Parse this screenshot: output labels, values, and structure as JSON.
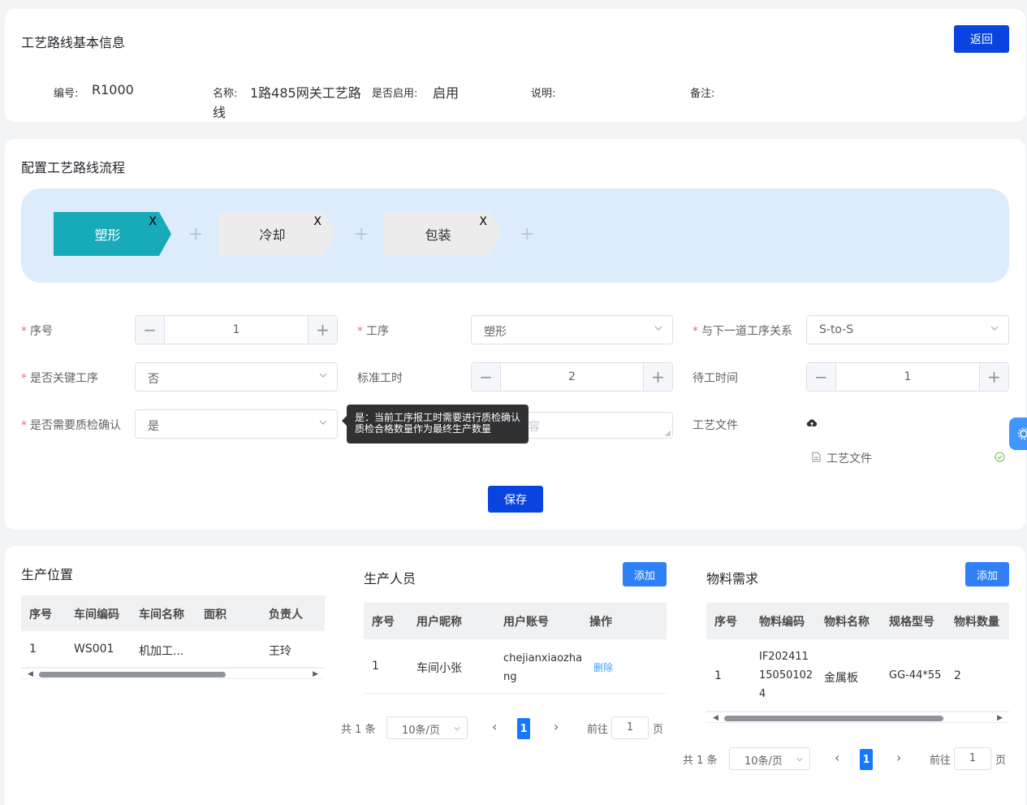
{
  "basic": {
    "title": "工艺路线基本信息",
    "back_label": "返回",
    "code_label": "编号:",
    "code_value": "R1000",
    "name_label": "名称:",
    "name_value_line1": "1路485网关工艺路",
    "name_value_line2": "线",
    "enabled_label": "是否启用:",
    "enabled_value": "启用",
    "desc_label": "说明:",
    "remark_label": "备注:"
  },
  "flow": {
    "title": "配置工艺路线流程",
    "steps": [
      {
        "label": "塑形",
        "close": "X"
      },
      {
        "label": "冷却",
        "close": "X"
      },
      {
        "label": "包装",
        "close": "X"
      }
    ],
    "plus": "+"
  },
  "form": {
    "seq_label": "序号",
    "seq_value": "1",
    "process_label": "工序",
    "process_value": "塑形",
    "relation_label": "与下一道工序关系",
    "relation_value": "S-to-S",
    "key_label": "是否关键工序",
    "key_value": "否",
    "std_label": "标准工时",
    "std_value": "2",
    "wait_label": "待工时间",
    "wait_value": "1",
    "qc_label": "是否需要质检确认",
    "qc_value": "是",
    "remark_placeholder_fragment": "容",
    "file_label": "工艺文件",
    "file_name": "工艺文件",
    "tooltip_line1": "是：当前工序报工时需要进行质检确认",
    "tooltip_line2": "质检合格数量作为最终生产数量",
    "save_label": "保存"
  },
  "location": {
    "title": "生产位置",
    "headers": [
      "序号",
      "车间编码",
      "车间名称",
      "面积",
      "负责人"
    ],
    "rows": [
      [
        "1",
        "WS001",
        "机加工...",
        "",
        "王玲"
      ]
    ]
  },
  "staff": {
    "title": "生产人员",
    "add_label": "添加",
    "headers": [
      "序号",
      "用户昵称",
      "用户账号",
      "操作"
    ],
    "rows": [
      {
        "seq": "1",
        "nick": "车间小张",
        "acct1": "chejianxiaozha",
        "acct2": "ng",
        "op": "删除"
      }
    ],
    "pager": {
      "total": "共 1 条",
      "size": "10条/页",
      "page": "1",
      "goto": "前往",
      "goto_value": "1",
      "unit": "页"
    }
  },
  "material": {
    "title": "物料需求",
    "add_label": "添加",
    "headers": [
      "序号",
      "物料编码",
      "物料名称",
      "规格型号",
      "物料数量"
    ],
    "rows": [
      {
        "seq": "1",
        "code1": "IF202411",
        "code2": "15050102",
        "code3": "4",
        "name": "金属板",
        "spec": "GG-44*55",
        "qty": "2"
      }
    ],
    "pager": {
      "total": "共 1 条",
      "size": "10条/页",
      "page": "1",
      "goto": "前往",
      "goto_value": "1",
      "unit": "页"
    }
  },
  "colors": {
    "primary": "#0a44e0",
    "accent": "#17aab8",
    "flow_bg": "#dcecfd"
  }
}
